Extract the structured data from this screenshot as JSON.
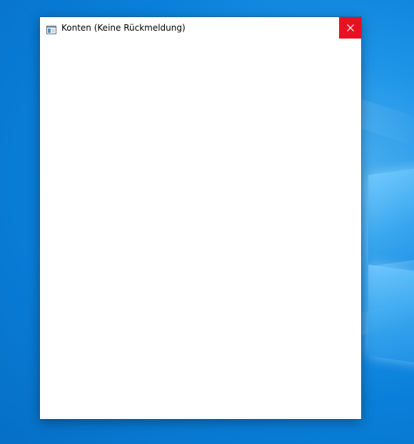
{
  "window": {
    "title": "Konten (Keine Rückmeldung)",
    "icon": "app-window-icon",
    "close_icon": "close-icon"
  },
  "colors": {
    "desktop_blue": "#0a7fd9",
    "close_red": "#e81123",
    "window_bg": "#ffffff"
  }
}
